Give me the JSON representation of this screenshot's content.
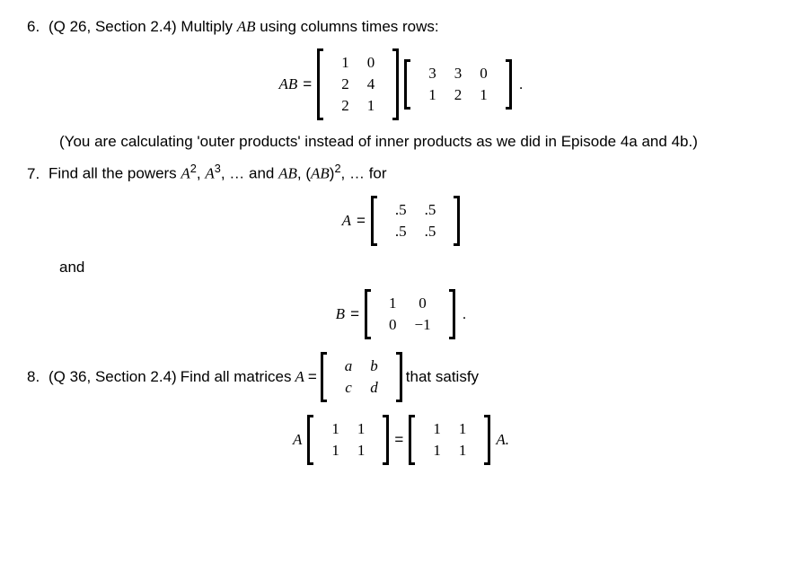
{
  "p6": {
    "num": "6.",
    "ref": "(Q 26, Section 2.4)",
    "text1": "Multiply ",
    "AB": "AB",
    "text2": " using columns times rows:",
    "eq_lhs": "AB",
    "eq_eq": "=",
    "M1": [
      [
        "1",
        "0"
      ],
      [
        "2",
        "4"
      ],
      [
        "2",
        "1"
      ]
    ],
    "M2": [
      [
        "3",
        "3",
        "0"
      ],
      [
        "1",
        "2",
        "1"
      ]
    ],
    "tail": ".",
    "note": "(You are calculating 'outer products' instead of inner products as we did in Episode 4a and 4b.)"
  },
  "p7": {
    "num": "7.",
    "text1": "Find all the powers ",
    "A2": "A",
    "sup2": "2",
    "comma1": ", ",
    "A3": "A",
    "sup3": "3",
    "text2": ", … and ",
    "AB": "AB",
    "comma2": ", (",
    "ABp": "AB",
    "supAB": "2",
    "text3": ", … for",
    "eqA_lhs": "A",
    "eqA_eq": "=",
    "MA": [
      [
        ".5",
        ".5"
      ],
      [
        ".5",
        ".5"
      ]
    ],
    "and": "and",
    "eqB_lhs": "B",
    "eqB_eq": "=",
    "MB": [
      [
        "1",
        "0"
      ],
      [
        "0",
        "−1"
      ]
    ],
    "tailB": "."
  },
  "p8": {
    "num": "8.",
    "ref": "(Q 36, Section 2.4)",
    "text1": "Find all matrices ",
    "A": "A",
    "eq": "=",
    "Mabcd": [
      [
        "a",
        "b"
      ],
      [
        "c",
        "d"
      ]
    ],
    "text2": " that satisfy",
    "lhsA": "A",
    "M11a": [
      [
        "1",
        "1"
      ],
      [
        "1",
        "1"
      ]
    ],
    "eq2": "=",
    "M11b": [
      [
        "1",
        "1"
      ],
      [
        "1",
        "1"
      ]
    ],
    "rhsA": "A.",
    "close": ")"
  }
}
